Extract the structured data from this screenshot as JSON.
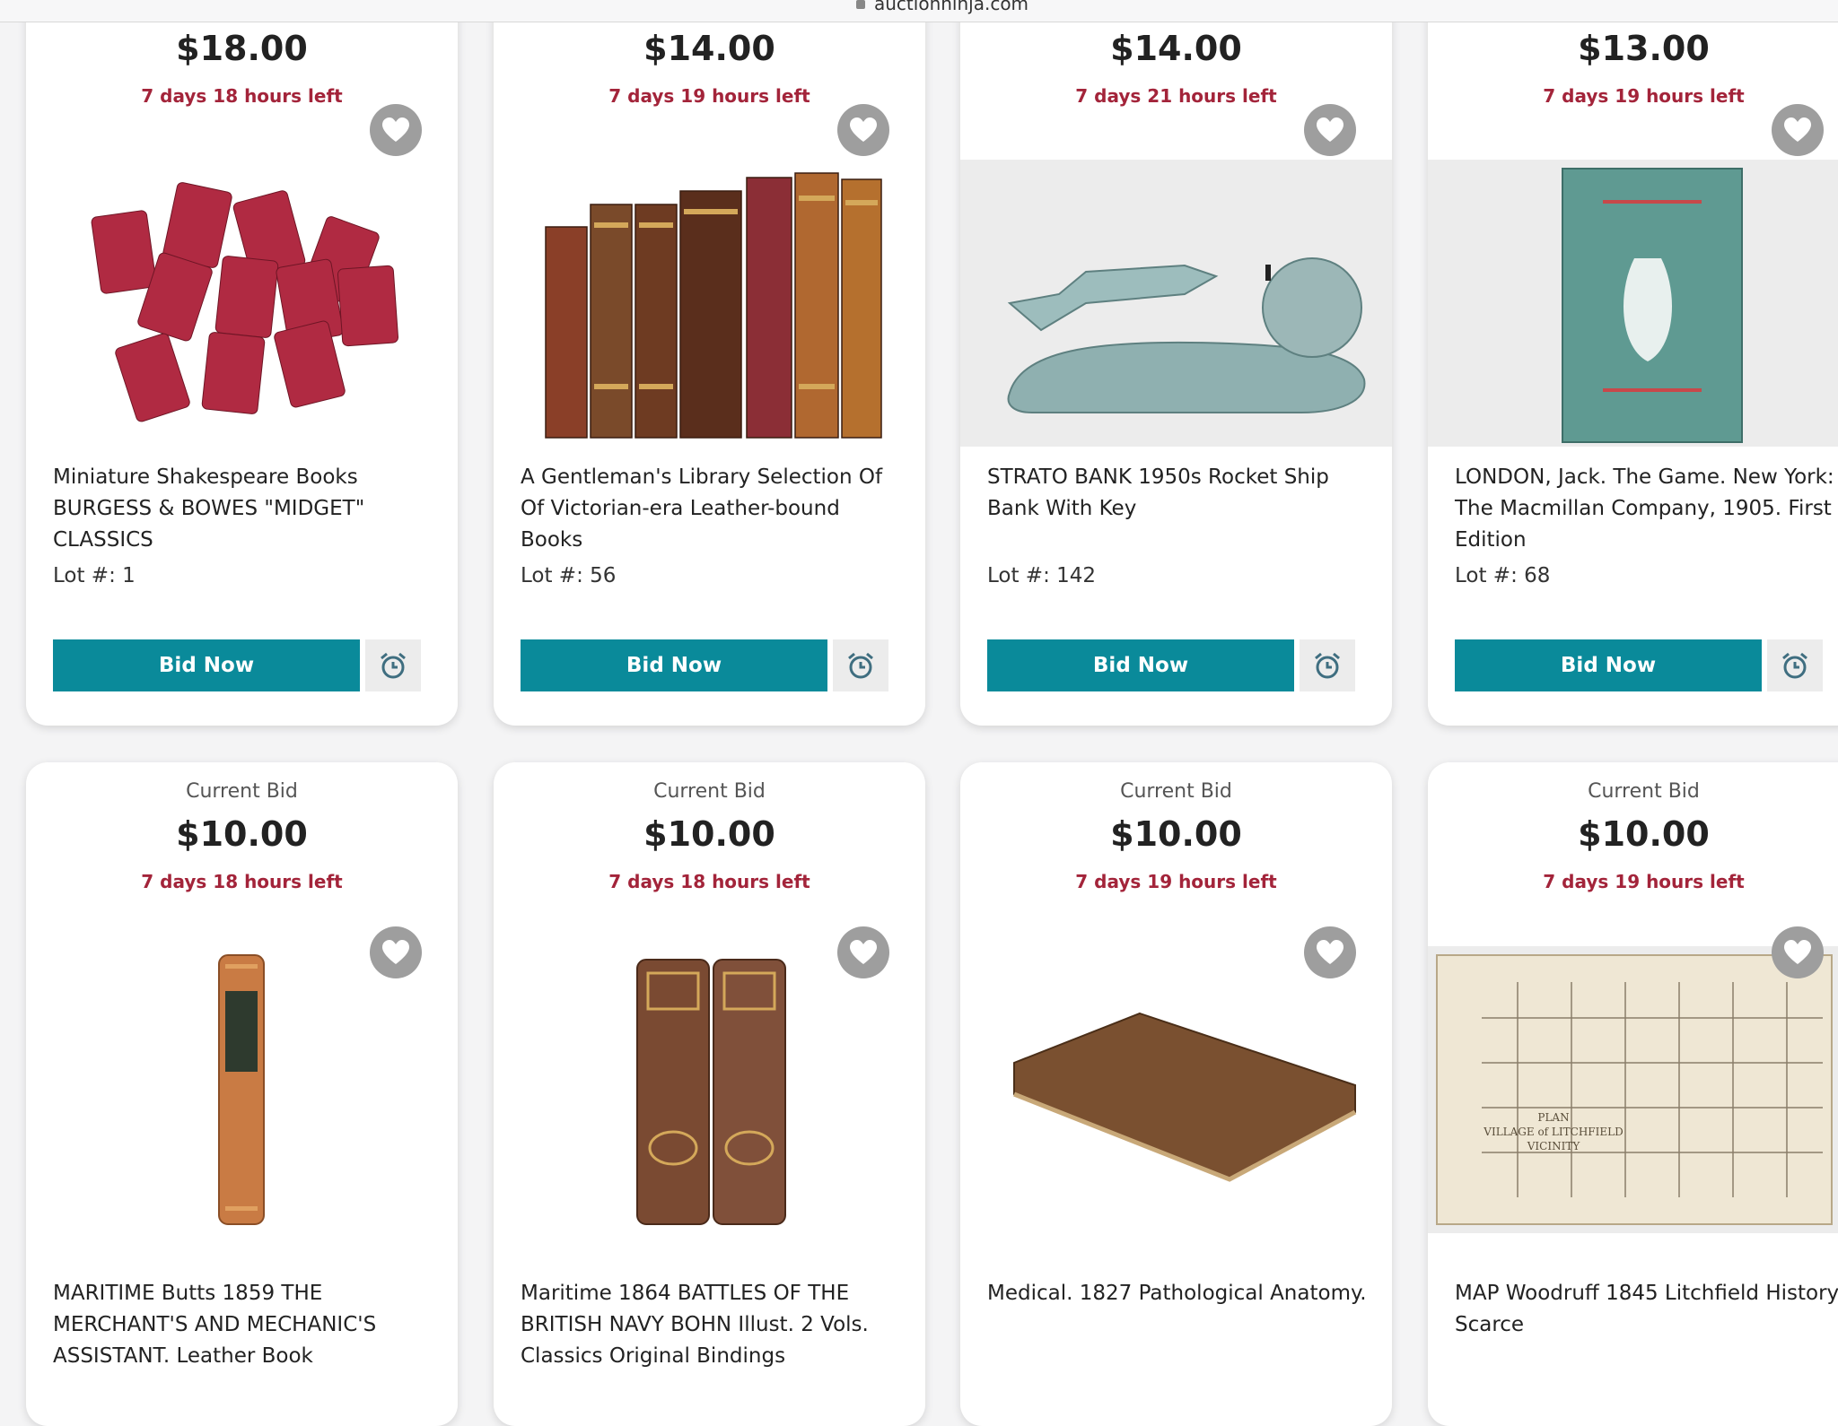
{
  "browser": {
    "url": "auctionninja.com"
  },
  "cards": [
    {
      "bid_label": "",
      "price": "$18.00",
      "time_left": "7 days 18 hours left",
      "title": "Miniature Shakespeare Books BURGESS & BOWES \"MIDGET\" CLASSICS",
      "lot": "Lot #: 1",
      "bid_button": "Bid Now",
      "image": "red-miniature-books"
    },
    {
      "bid_label": "",
      "price": "$14.00",
      "time_left": "7 days 19 hours left",
      "title": "A Gentleman's Library Selection Of Of Victorian-era Leather-bound Books",
      "lot": "Lot #: 56",
      "bid_button": "Bid Now",
      "image": "leather-bound-books"
    },
    {
      "bid_label": "",
      "price": "$14.00",
      "time_left": "7 days 21 hours left",
      "title": "STRATO BANK 1950s Rocket Ship Bank With Key",
      "lot": "Lot #: 142",
      "bid_button": "Bid Now",
      "image": "rocket-ship-bank"
    },
    {
      "bid_label": "",
      "price": "$13.00",
      "time_left": "7 days 19 hours left",
      "title": "LONDON, Jack. The Game. New York: The Macmillan Company, 1905. First Edition",
      "lot": "Lot #: 68",
      "bid_button": "Bid Now",
      "image": "green-book-the-game"
    },
    {
      "bid_label": "Current Bid",
      "price": "$10.00",
      "time_left": "7 days 18 hours left",
      "title": "MARITIME Butts 1859 THE MERCHANT'S AND MECHANIC'S ASSISTANT. Leather Book",
      "lot": "",
      "bid_button": "",
      "image": "single-leather-spine"
    },
    {
      "bid_label": "Current Bid",
      "price": "$10.00",
      "time_left": "7 days 18 hours left",
      "title": "Maritime 1864 BATTLES OF THE BRITISH NAVY BOHN Illust. 2 Vols. Classics Original Bindings",
      "lot": "",
      "bid_button": "",
      "image": "two-volume-spines"
    },
    {
      "bid_label": "Current Bid",
      "price": "$10.00",
      "time_left": "7 days 19 hours left",
      "title": "Medical. 1827 Pathological Anatomy.",
      "lot": "",
      "bid_button": "",
      "image": "worn-brown-book"
    },
    {
      "bid_label": "Current Bid",
      "price": "$10.00",
      "time_left": "7 days 19 hours left",
      "title": "MAP Woodruff 1845 Litchfield History Scarce",
      "lot": "",
      "bid_button": "",
      "image": "folded-village-map"
    }
  ],
  "icons": {
    "favorite": "heart-icon",
    "reminder": "alarm-clock-icon"
  },
  "colors": {
    "button": "#0a8a9a",
    "time_left": "#a3243a",
    "heart": "#9e9e9e"
  },
  "map_text": {
    "line1": "PLAN",
    "line2": "VILLAGE of LITCHFIELD",
    "line3": "VICINITY"
  }
}
